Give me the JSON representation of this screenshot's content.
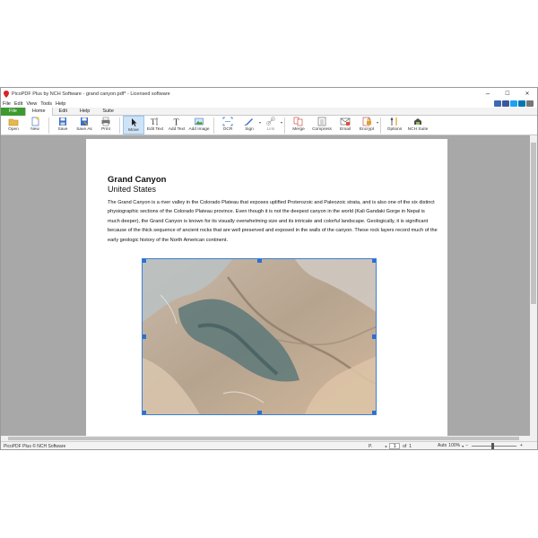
{
  "window": {
    "title": "PicoPDF Plus by NCH Software - grand canyon.pdf* - Licensed software",
    "minimize": "–",
    "maximize": "☐",
    "close": "✕"
  },
  "menu": [
    "File",
    "Edit",
    "View",
    "Tools",
    "Help"
  ],
  "social_colors": [
    "#4267b2",
    "#3b5998",
    "#1da1f2",
    "#0077b5",
    "#777777"
  ],
  "ribbon_tabs": [
    "File",
    "Home",
    "Edit",
    "Help",
    "Suite"
  ],
  "toolbar": {
    "open": "Open",
    "new": "New",
    "save": "Save",
    "save_as": "Save As",
    "print": "Print",
    "move": "Move",
    "edit_text": "Edit Text",
    "add_text": "Add Text",
    "add_image": "Add Image",
    "ocr": "OCR",
    "sign": "Sign",
    "link": "Link",
    "merge": "Merge",
    "compress": "Compress",
    "email": "Email",
    "encrypt": "Encrypt",
    "options": "Options",
    "nch_suite": "NCH Suite"
  },
  "document": {
    "title": "Grand Canyon",
    "subtitle": "United States",
    "body": "The Grand Canyon is a river valley in the Colorado Plateau that exposes uplifted Proterozoic and Paleozoic strata, and is also one of the six distinct physiographic sections of the Colorado Plateau province. Even though it is not the deepest canyon in the world (Kali Gandaki Gorge in Nepal is much deeper), the Grand Canyon is known for its visually overwhelming size and its intricate and colorful landscape. Geologically, it is significant because of the thick sequence of ancient rocks that are well preserved and exposed in the walls of the canyon. These rock layers record much of the early geologic history of the North American continent."
  },
  "status": {
    "text": "PicoPDF Plus © NCH Software",
    "page_label": "P.",
    "page_value": "1",
    "of_label": "of",
    "total_pages": "1",
    "zoom_mode": "Auto",
    "zoom_value": "100%",
    "zoom_minus": "−",
    "zoom_plus": "+"
  },
  "colors": {
    "file_tab": "#3c9a2e",
    "selection": "#2e6fd1",
    "workspace": "#a8a8a8"
  }
}
